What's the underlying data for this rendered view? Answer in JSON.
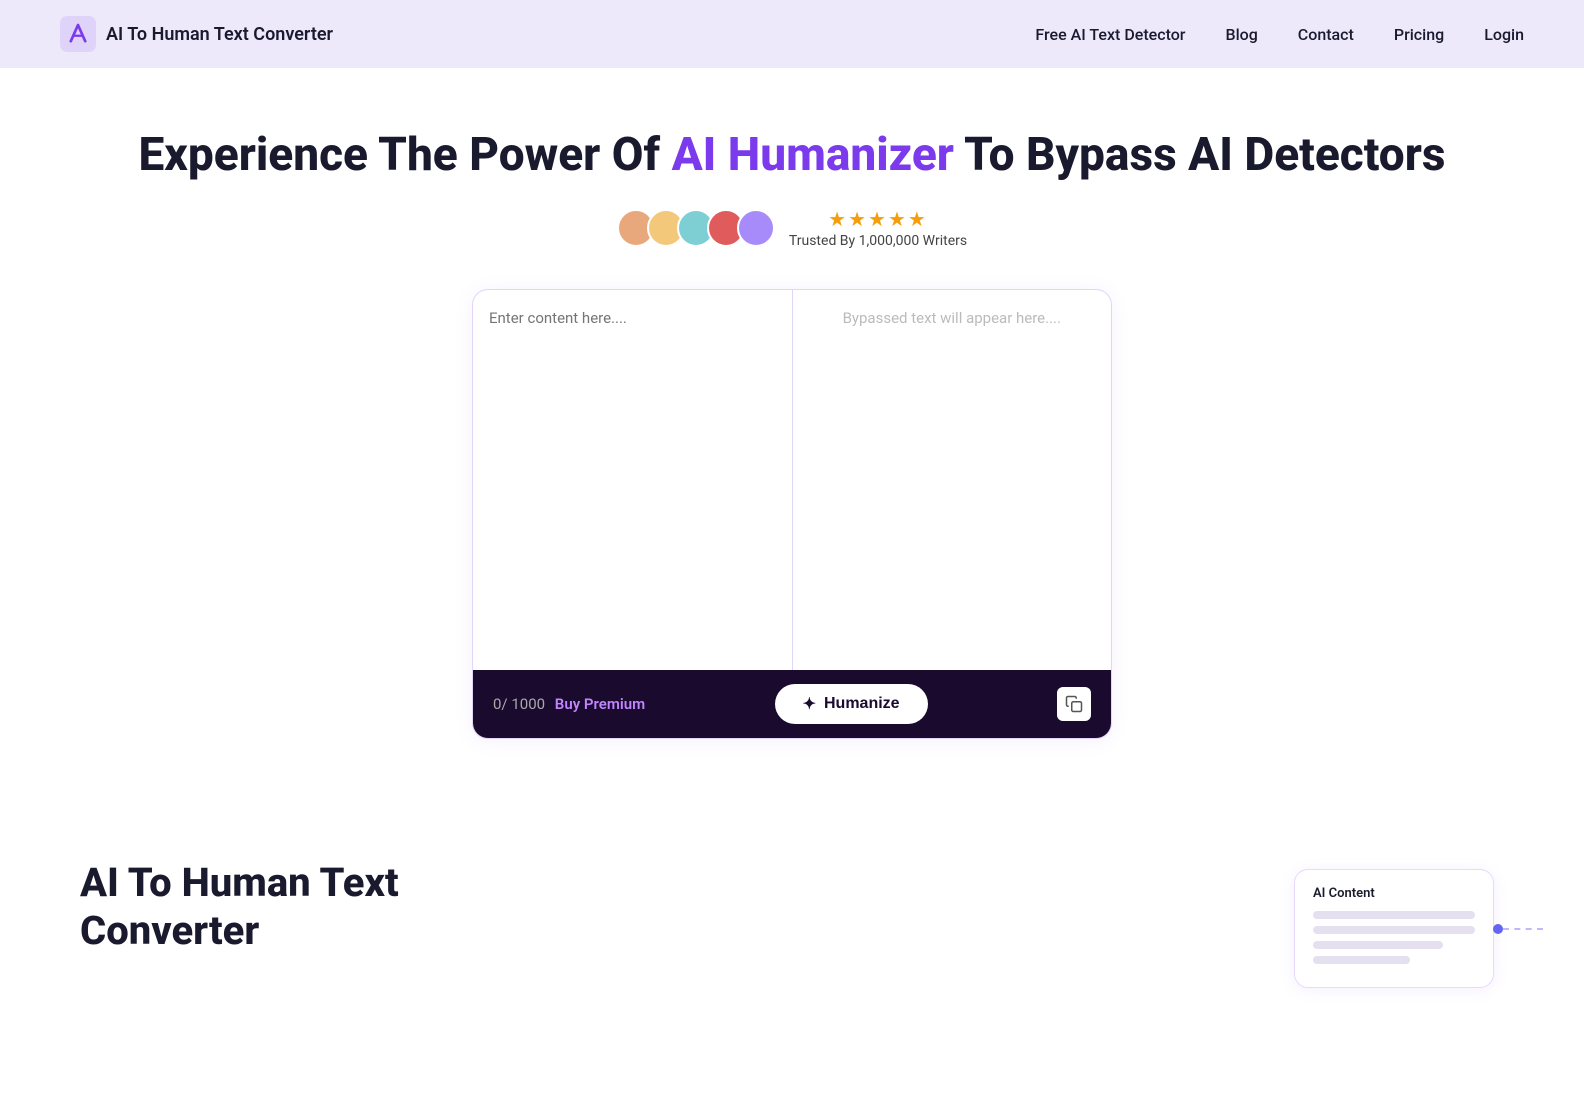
{
  "navbar": {
    "logo_text": "AI To Human Text Converter",
    "links": [
      {
        "id": "free-detector",
        "label": "Free AI Text Detector",
        "href": "#"
      },
      {
        "id": "blog",
        "label": "Blog",
        "href": "#"
      },
      {
        "id": "contact",
        "label": "Contact",
        "href": "#"
      },
      {
        "id": "pricing",
        "label": "Pricing",
        "href": "#"
      },
      {
        "id": "login",
        "label": "Login",
        "href": "#"
      }
    ]
  },
  "hero": {
    "title_part1": "Experience The Power Of ",
    "title_highlight": "AI Humanizer",
    "title_part2": " To Bypass AI Detectors",
    "stars": "★★★★★",
    "trust_text": "Trusted By 1,000,000 Writers",
    "avatars": [
      {
        "id": "avatar-1",
        "initial": ""
      },
      {
        "id": "avatar-2",
        "initial": ""
      },
      {
        "id": "avatar-3",
        "initial": ""
      },
      {
        "id": "avatar-4",
        "initial": ""
      },
      {
        "id": "avatar-5",
        "initial": ""
      }
    ]
  },
  "tool": {
    "input_placeholder": "Enter content here....",
    "output_placeholder": "Bypassed text will appear here....",
    "word_count": "0/ 1000",
    "buy_premium_label": "Buy Premium",
    "humanize_label": "Humanize",
    "sparkle": "✦"
  },
  "bottom": {
    "title_line1": "AI To Human Text",
    "title_line2": "Converter",
    "card_label": "AI Content",
    "card_lines": [
      "long",
      "long",
      "medium",
      "short"
    ]
  }
}
